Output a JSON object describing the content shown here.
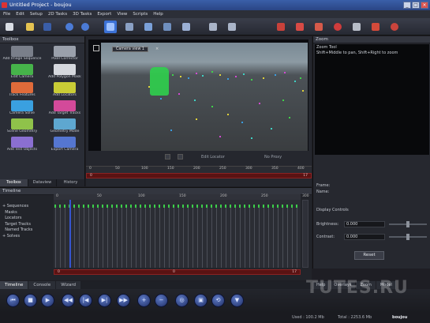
{
  "window": {
    "title": "Untitled Project - boujou",
    "min": "_",
    "max": "□",
    "close": "×"
  },
  "menu": [
    "File",
    "Edit",
    "Setup",
    "2D Tasks",
    "3D Tasks",
    "Export",
    "View",
    "Scripts",
    "Help"
  ],
  "toolbox": {
    "title": "Toolbox",
    "tools": [
      {
        "label": "Add Image Sequence",
        "color": "#7a7f8a"
      },
      {
        "label": "Pixel Corrector",
        "color": "#9aa0ab"
      },
      {
        "label": "Edit Camera",
        "color": "#46b34a"
      },
      {
        "label": "Add Polygon Mask",
        "color": "#d5d8de"
      },
      {
        "label": "Track Features",
        "color": "#e06b3a"
      },
      {
        "label": "Add Locators",
        "color": "#c9cc36"
      },
      {
        "label": "Camera Solve",
        "color": "#3aa0e0"
      },
      {
        "label": "Add Target Tracks",
        "color": "#d34a9a"
      },
      {
        "label": "Scene Geometry",
        "color": "#8fc24a"
      },
      {
        "label": "Geometry Mode",
        "color": "#5ea7d0"
      },
      {
        "label": "Add Test Objects",
        "color": "#8a6fd1"
      },
      {
        "label": "Export Camera",
        "color": "#5576d0"
      }
    ],
    "tabs": [
      "Toolbox",
      "Dataview",
      "History"
    ]
  },
  "viewport": {
    "camera_tag": "Camera view 1",
    "close_glyph": "×",
    "edit_label": "Edit Locator",
    "proxy_label": "No Proxy",
    "ruler_labels": [
      "0",
      "50",
      "100",
      "150",
      "200",
      "250",
      "300",
      "350",
      "400"
    ],
    "range_start": "0",
    "range_end": "17"
  },
  "zoom": {
    "title": "Zoom",
    "hint_line1": "Zoom Tool",
    "hint_line2": "Shift+Middle to pan, Shift+Right to zoom",
    "frame_label": "Frame:",
    "name_label": "Name:",
    "display_title": "Display Controls",
    "brightness_label": "Brightness:",
    "brightness_value": "0.000",
    "contrast_label": "Contrast:",
    "contrast_value": "0.000",
    "reset_label": "Reset"
  },
  "timeline": {
    "title": "Timeline",
    "tree": [
      "Sequences",
      "Masks",
      "Locators",
      "Target Tracks",
      "Named Tracks",
      "Solves"
    ],
    "ruler_labels": [
      "0",
      "50",
      "100",
      "150",
      "200",
      "250",
      "300"
    ],
    "range_start": "0",
    "range_mid": "0",
    "range_end": "17"
  },
  "bottom_tabs": [
    "Timeline",
    "Console",
    "Wizard"
  ],
  "right_tabs": [
    "Help",
    "Overlays",
    "Zoom",
    "Model"
  ],
  "transport": [
    {
      "name": "rewind-icon",
      "glyph": "⏮"
    },
    {
      "name": "stop-icon",
      "glyph": "■"
    },
    {
      "name": "play-icon",
      "glyph": "▶"
    },
    {
      "name": "prev-key-icon",
      "glyph": "◀◀"
    },
    {
      "name": "prev-frame-icon",
      "glyph": "|◀"
    },
    {
      "name": "next-frame-icon",
      "glyph": "▶|"
    },
    {
      "name": "next-key-icon",
      "glyph": "▶▶"
    },
    {
      "name": "zoom-in-icon",
      "glyph": "+"
    },
    {
      "name": "zoom-out-icon",
      "glyph": "−"
    },
    {
      "name": "fit-icon",
      "glyph": "◎"
    },
    {
      "name": "frame-icon",
      "glyph": "▣"
    },
    {
      "name": "loop-icon",
      "glyph": "⟲"
    },
    {
      "name": "folder-icon",
      "glyph": "▼"
    }
  ],
  "status": {
    "used": "Used : 100.2 Mb",
    "total": "Total : 2253.6 Mb",
    "brand": "boujou"
  },
  "watermark": "TUTES.RU"
}
